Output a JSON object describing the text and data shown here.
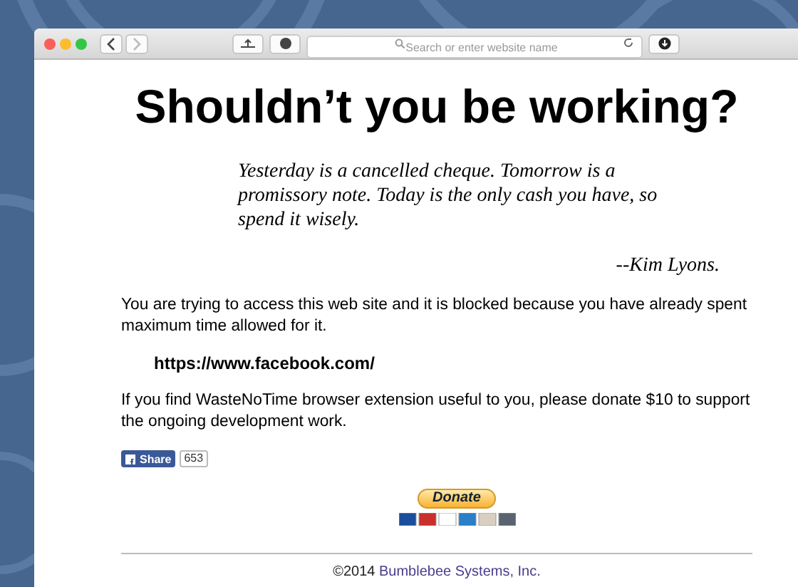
{
  "toolbar": {
    "address_placeholder": "Search or enter website name"
  },
  "page": {
    "title": "Shouldn’t you be working?",
    "quote": "Yesterday is a cancelled cheque. Tomorrow is a promissory note. Today is the only cash you have, so spend it wisely.",
    "author": "--Kim Lyons.",
    "message": "You are trying to access this web site and it is blocked because you have already spent maximum time allowed for it.",
    "blocked_url": "https://www.facebook.com/",
    "donate_message": "If you find WasteNoTime browser extension useful to you, please donate $10 to support the ongoing development work.",
    "share": {
      "label": "Share",
      "count": "653"
    },
    "donate_button": "Donate",
    "footer": {
      "copyright": "©2014",
      "company": "Bumblebee Systems, Inc."
    }
  }
}
